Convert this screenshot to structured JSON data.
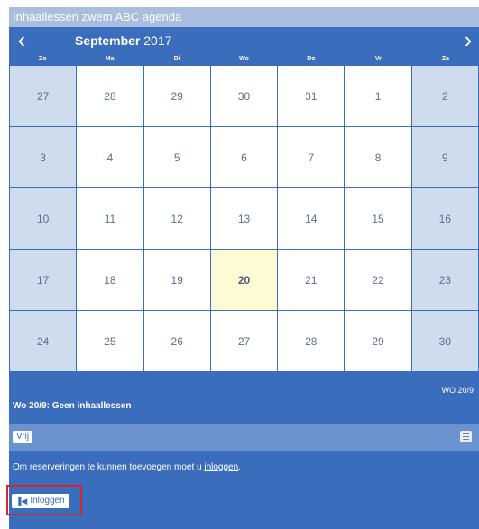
{
  "header": {
    "title": "Inhaallessen zwem ABC agenda"
  },
  "nav": {
    "prev": "‹",
    "next": "›",
    "month": "September",
    "year": "2017"
  },
  "weekdays": [
    "Zo",
    "Ma",
    "Di",
    "Wo",
    "Do",
    "Vr",
    "Za"
  ],
  "weeks": [
    [
      "27",
      "28",
      "29",
      "30",
      "31",
      "1",
      "2"
    ],
    [
      "3",
      "4",
      "5",
      "6",
      "7",
      "8",
      "9"
    ],
    [
      "10",
      "11",
      "12",
      "13",
      "14",
      "15",
      "16"
    ],
    [
      "17",
      "18",
      "19",
      "20",
      "21",
      "22",
      "23"
    ],
    [
      "24",
      "25",
      "26",
      "27",
      "28",
      "29",
      "30"
    ]
  ],
  "today_label": "20",
  "selected": {
    "date_tag": "WO 20/9",
    "status": "Wo 20/9: Geen inhaallessen"
  },
  "filter": {
    "vrij_label": "Vrij",
    "list_icon": "list-icon"
  },
  "info": {
    "text_prefix": "Om reserveringen te kunnen toevoegen moet u ",
    "link": "inloggen",
    "text_suffix": "."
  },
  "login": {
    "icon": "login-icon",
    "glyph": "▐◀",
    "label": "Inloggen"
  },
  "colors": {
    "primary": "#3b6dbd",
    "header": "#a9bedf",
    "weekend": "#cfdcee",
    "today": "#fdfbd4",
    "filterbar": "#6b93cf",
    "highlight": "#d6262b"
  }
}
